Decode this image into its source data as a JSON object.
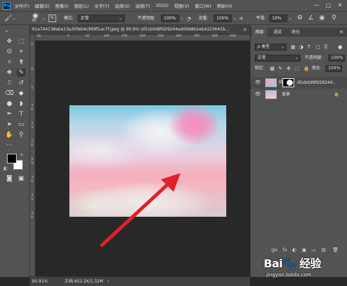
{
  "app": {
    "logo": "Ps"
  },
  "menu": [
    "文件(F)",
    "编辑(E)",
    "图像(I)",
    "图层(L)",
    "文字(Y)",
    "选择(S)",
    "滤镜(T)",
    "3D(D)",
    "视图(V)",
    "窗口(W)",
    "帮助(H)"
  ],
  "window_controls": {
    "minimize": "—",
    "maximize": "□",
    "close": "✕"
  },
  "options_bar": {
    "brush_size": "90",
    "mode_label": "模式:",
    "mode_value": "正常",
    "opacity_label": "不透明度:",
    "opacity_value": "100%",
    "flow_label": "流量:",
    "flow_value": "100%",
    "smooth_label": "平滑:",
    "smooth_value": "10%"
  },
  "document": {
    "tab_title": "91e744138aba13a30feb4c999f1ac7f.jpeg @ 90.9% (d5cb0d9fd29244ed06b8b2eb4223641b...",
    "close": "×"
  },
  "ruler": {
    "h_ticks": [
      "50",
      "0",
      "50",
      "100",
      "150",
      "200",
      "250",
      "300",
      "350",
      "400",
      "450"
    ],
    "v_ticks": [
      "5",
      "0",
      "5",
      "1\n0",
      "1\n5",
      "2\n0",
      "2\n5",
      "3\n0",
      "3\n5",
      "4\n0"
    ]
  },
  "panels": {
    "tabs": [
      "图层",
      "通道",
      "路径"
    ],
    "active_tab": "图层",
    "filter_label": "ρ 类型",
    "blend_mode": "正常",
    "opacity_label": "不透明度:",
    "opacity_value": "100%",
    "lock_label": "锁定:",
    "fill_label": "填充:",
    "fill_value": "100%",
    "layers": [
      {
        "name": "d5cb0d9fd29244...",
        "selected": true
      },
      {
        "name": "背景",
        "selected": false
      }
    ],
    "bottom_icons": [
      "go",
      "fx",
      "◐",
      "▣",
      "▭",
      "▤",
      "🗑"
    ]
  },
  "status": {
    "zoom": "90.91%",
    "doc": "文档:402.2K/1.32M",
    "arrow": "›"
  },
  "watermark": {
    "brand": "Bai🐾 经验",
    "url": "jingyan.baidu.com"
  },
  "colors": {
    "chrome": "#535353",
    "canvas_bg": "#282828",
    "arrow": "#e0202a",
    "active_tool": "#3b3b3b"
  }
}
